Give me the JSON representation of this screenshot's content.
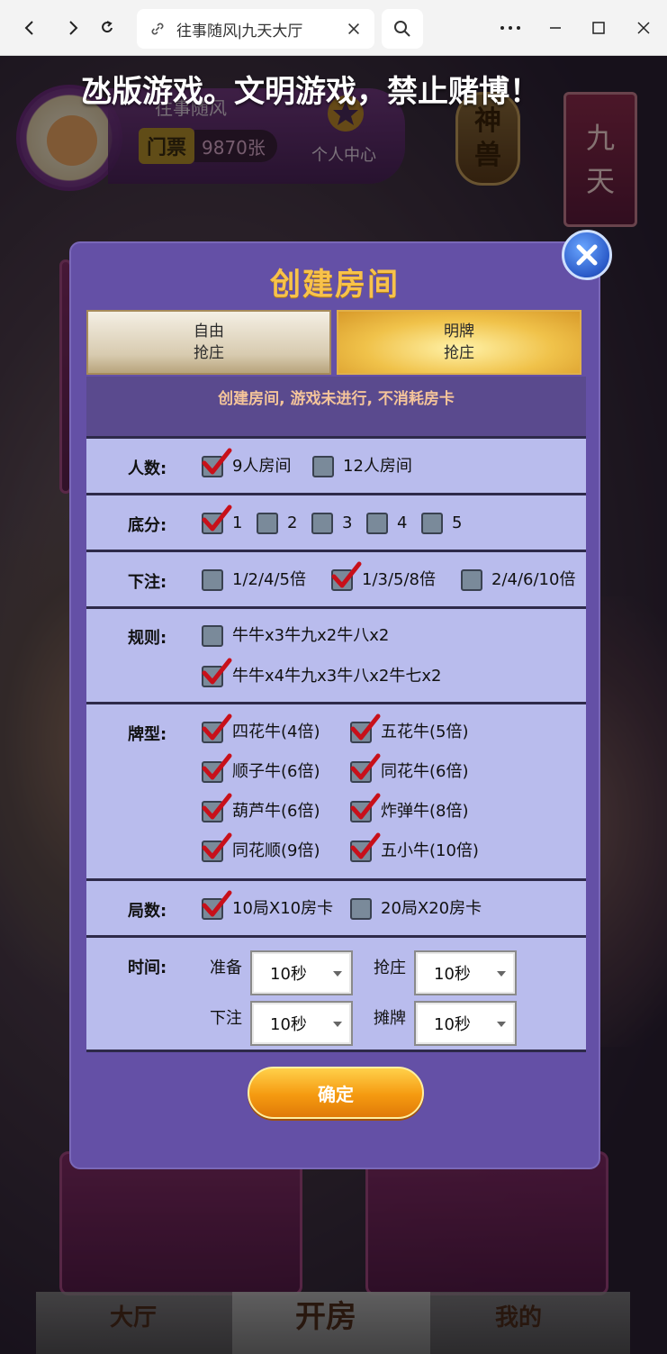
{
  "browser": {
    "tab_title": "往事随风|九天大厅",
    "icons": [
      "back-icon",
      "forward-icon",
      "refresh-icon",
      "link-icon",
      "close-icon",
      "search-icon",
      "more-icon",
      "minimize-icon",
      "maximize-icon",
      "window-close-icon"
    ]
  },
  "game": {
    "marquee": "氹版游戏。文明游戏，禁止赌博！",
    "player_name": "往事随风",
    "ticket_label": "门票",
    "ticket_count": "9870张",
    "personal_center": "个人中心",
    "beast_line1": "神",
    "beast_line2": "兽",
    "nine_line1": "九",
    "nine_line2": "天",
    "nav": {
      "hall": "大厅",
      "create": "开房",
      "mine": "我的"
    }
  },
  "dialog": {
    "title": "创建房间",
    "tabs": [
      {
        "line1": "自由",
        "line2": "抢庄",
        "selected": false
      },
      {
        "line1": "明牌",
        "line2": "抢庄",
        "selected": true
      }
    ],
    "notice": "创建房间, 游戏未进行, 不消耗房卡",
    "players": {
      "label": "人数:",
      "options": [
        {
          "text": "9人房间",
          "checked": true
        },
        {
          "text": "12人房间",
          "checked": false
        }
      ]
    },
    "base_score": {
      "label": "底分:",
      "options": [
        {
          "text": "1",
          "checked": true
        },
        {
          "text": "2",
          "checked": false
        },
        {
          "text": "3",
          "checked": false
        },
        {
          "text": "4",
          "checked": false
        },
        {
          "text": "5",
          "checked": false
        }
      ]
    },
    "bet": {
      "label": "下注:",
      "options": [
        {
          "text": "1/2/4/5倍",
          "checked": false
        },
        {
          "text": "1/3/5/8倍",
          "checked": true
        },
        {
          "text": "2/4/6/10倍",
          "checked": false
        }
      ]
    },
    "rules": {
      "label": "规则:",
      "options": [
        {
          "text": "牛牛x3牛九x2牛八x2",
          "checked": false
        },
        {
          "text": "牛牛x4牛九x3牛八x2牛七x2",
          "checked": true
        }
      ]
    },
    "card_types": {
      "label": "牌型:",
      "options": [
        {
          "text": "四花牛(4倍)",
          "checked": true
        },
        {
          "text": "五花牛(5倍)",
          "checked": true
        },
        {
          "text": "顺子牛(6倍)",
          "checked": true
        },
        {
          "text": "同花牛(6倍)",
          "checked": true
        },
        {
          "text": "葫芦牛(6倍)",
          "checked": true
        },
        {
          "text": "炸弹牛(8倍)",
          "checked": true
        },
        {
          "text": "同花顺(9倍)",
          "checked": true
        },
        {
          "text": "五小牛(10倍)",
          "checked": true
        }
      ]
    },
    "rounds": {
      "label": "局数:",
      "options": [
        {
          "text": "10局X10房卡",
          "checked": true
        },
        {
          "text": "20局X20房卡",
          "checked": false
        }
      ]
    },
    "time": {
      "label": "时间:",
      "prepare_label": "准备",
      "prepare_value": "10秒",
      "grab_label": "抢庄",
      "grab_value": "10秒",
      "bet_label": "下注",
      "bet_value": "10秒",
      "show_label": "摊牌",
      "show_value": "10秒"
    },
    "confirm": "确定"
  },
  "colors": {
    "dialog_bg": "#6450a6",
    "content_bg": "#b9bced",
    "title": "#f8c24a",
    "notice_text": "#f4c49a",
    "check_red": "#c8101a",
    "confirm": "#f59a10"
  }
}
